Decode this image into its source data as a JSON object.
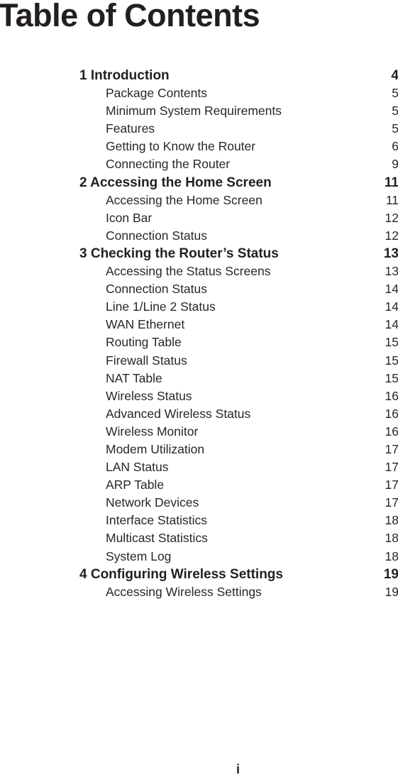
{
  "title": "Table of Contents",
  "toc": [
    {
      "type": "chapter",
      "label": "1 Introduction",
      "page": "4"
    },
    {
      "type": "section",
      "label": "Package Contents",
      "page": "5"
    },
    {
      "type": "section",
      "label": "Minimum System Requirements",
      "page": "5"
    },
    {
      "type": "section",
      "label": "Features",
      "page": "5"
    },
    {
      "type": "section",
      "label": "Getting to Know the Router",
      "page": "6"
    },
    {
      "type": "section",
      "label": "Connecting the Router",
      "page": "9"
    },
    {
      "type": "chapter",
      "label": "2 Accessing the Home Screen",
      "page": "11"
    },
    {
      "type": "section",
      "label": "Accessing the Home Screen",
      "page": "11"
    },
    {
      "type": "section",
      "label": "Icon Bar",
      "page": "12"
    },
    {
      "type": "section",
      "label": "Connection Status",
      "page": "12"
    },
    {
      "type": "chapter",
      "label": "3 Checking the Router’s Status",
      "page": "13"
    },
    {
      "type": "section",
      "label": "Accessing the Status Screens",
      "page": "13"
    },
    {
      "type": "section",
      "label": "Connection Status",
      "page": "14"
    },
    {
      "type": "section",
      "label": "Line 1/Line 2 Status",
      "page": "14"
    },
    {
      "type": "section",
      "label": "WAN Ethernet",
      "page": "14"
    },
    {
      "type": "section",
      "label": "Routing Table",
      "page": "15"
    },
    {
      "type": "section",
      "label": "Firewall Status",
      "page": "15"
    },
    {
      "type": "section",
      "label": "NAT Table",
      "page": "15"
    },
    {
      "type": "section",
      "label": "Wireless Status",
      "page": "16"
    },
    {
      "type": "section",
      "label": "Advanced Wireless Status",
      "page": "16"
    },
    {
      "type": "section",
      "label": "Wireless Monitor",
      "page": "16"
    },
    {
      "type": "section",
      "label": "Modem Utilization",
      "page": "17"
    },
    {
      "type": "section",
      "label": "LAN Status",
      "page": "17"
    },
    {
      "type": "section",
      "label": "ARP Table",
      "page": "17"
    },
    {
      "type": "section",
      "label": "Network Devices",
      "page": "17"
    },
    {
      "type": "section",
      "label": "Interface Statistics",
      "page": "18"
    },
    {
      "type": "section",
      "label": "Multicast Statistics",
      "page": "18"
    },
    {
      "type": "section",
      "label": "System Log",
      "page": "18"
    },
    {
      "type": "chapter",
      "label": "4 Configuring Wireless Settings",
      "page": "19"
    },
    {
      "type": "section",
      "label": "Accessing Wireless Settings",
      "page": "19"
    }
  ],
  "footer": {
    "page_number": "i"
  }
}
